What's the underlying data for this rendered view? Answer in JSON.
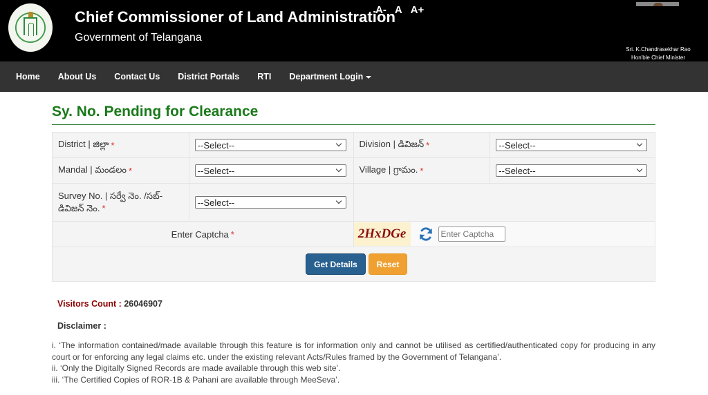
{
  "header": {
    "title": "Chief Commissioner of Land Administration",
    "subtitle": "Government of Telangana",
    "font_size_controls": [
      "A-",
      "A",
      "A+"
    ],
    "official_name": "Sri. K.Chandrasekhar Rao",
    "official_designation": "Hon'ble Chief Minister"
  },
  "nav": {
    "items": [
      {
        "label": "Home"
      },
      {
        "label": "About Us"
      },
      {
        "label": "Contact Us"
      },
      {
        "label": "District Portals"
      },
      {
        "label": "RTI"
      },
      {
        "label": "Department Login",
        "dropdown": true
      }
    ]
  },
  "page": {
    "title": "Sy. No. Pending for Clearance"
  },
  "form": {
    "required_marker": "*",
    "district": {
      "label": "District | జిల్లా",
      "value": "--Select--"
    },
    "division": {
      "label": "Division | డివిజన్",
      "value": "--Select--"
    },
    "mandal": {
      "label": "Mandal | మండలం",
      "value": "--Select--"
    },
    "village": {
      "label": "Village | గ్రామం.",
      "value": "--Select--"
    },
    "survey": {
      "label": "Survey No. | సర్వే నెం. /సబ్-డివిజన్ నెం.",
      "value": "--Select--"
    },
    "captcha": {
      "label": "Enter Captcha",
      "code": "2HxDGe",
      "input_placeholder": "Enter Captcha",
      "input_value": ""
    },
    "buttons": {
      "submit": "Get Details",
      "reset": "Reset"
    }
  },
  "footer": {
    "visitors_label": "Visitors Count :",
    "visitors_count": "26046907",
    "disclaimer_title": "Disclaimer :",
    "disclaimer_items": [
      "i. ‘The information contained/made available through this feature is for information only and cannot be utilised as certified/authenticated copy for producing in any court or for enforcing any legal claims etc. under the existing relevant Acts/Rules framed by the Government of Telangana’.",
      "ii. ‘Only the Digitally Signed Records are made available through this web site’.",
      "iii. ‘The Certified Copies of ROR-1B & Pahani are available through MeeSeva’."
    ]
  },
  "colors": {
    "header_bg": "#000000",
    "nav_bg": "#333333",
    "title_green": "#1a7a1a",
    "primary_button": "#286090",
    "warning_button": "#f0a030",
    "visitors_label": "#8b0000",
    "required": "#d9302c"
  }
}
